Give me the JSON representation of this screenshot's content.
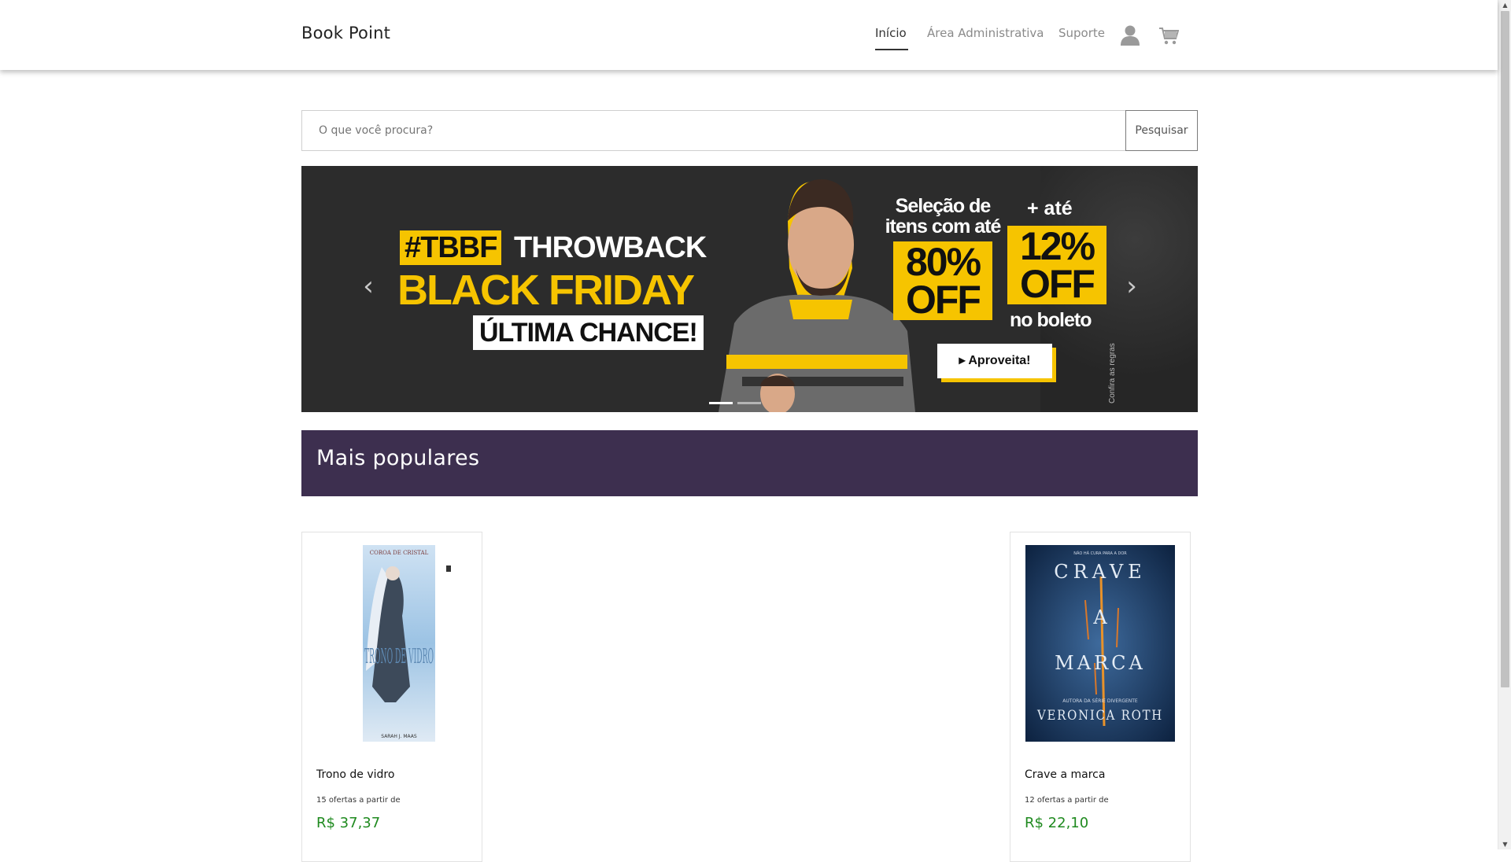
{
  "brand": "Book Point",
  "nav": {
    "links": [
      "Início",
      "Área Administrativa",
      "Suporte"
    ],
    "active": "Início"
  },
  "icons": {
    "user": "user-icon",
    "cart": "cart-icon"
  },
  "search": {
    "placeholder": "O que você procura?",
    "button_label": "Pesquisar"
  },
  "banner": {
    "tag_hashtag": "#TBBF",
    "tag_throwback": "THROWBACK",
    "headline": "BLACK FRIDAY",
    "subheadline": "ÚLTIMA CHANCE!",
    "selection_text": "Seleção de itens com até",
    "discount_1": "80% OFF",
    "plus_text": "+ até",
    "discount_2": "12% OFF",
    "boleto_text": "no boleto",
    "cta_label": "▸ Aproveita!",
    "rules_text": "Confira as regras",
    "prev_arrow": "‹",
    "next_arrow": "›",
    "slides": 2,
    "active_slide": 1,
    "accent_color": "#f6c400"
  },
  "section": {
    "title": "Mais populares",
    "background": "#3d2f4f"
  },
  "products": [
    {
      "title": "Trono de vidro",
      "offers": "15 ofertas a partir de",
      "price": "R$ 37,37",
      "cover_author": "COROA DE CRISTAL",
      "cover_title": "TRONO DE VIDRO",
      "cover_sub": "SARAH J. MAAS"
    },
    {
      "title": "Crave a marca",
      "offers": "12 ofertas a partir de",
      "price": "R$ 22,10",
      "cover_top": "NÃO HÁ CURA PARA A DOR",
      "cover_title_1": "CRAVE",
      "cover_title_2": "A",
      "cover_title_3": "MARCA",
      "cover_sub": "AUTORA DA SÉRIE DIVERGENTE",
      "cover_author": "VERONICA ROTH"
    }
  ],
  "price_color": "#1f8a1f"
}
